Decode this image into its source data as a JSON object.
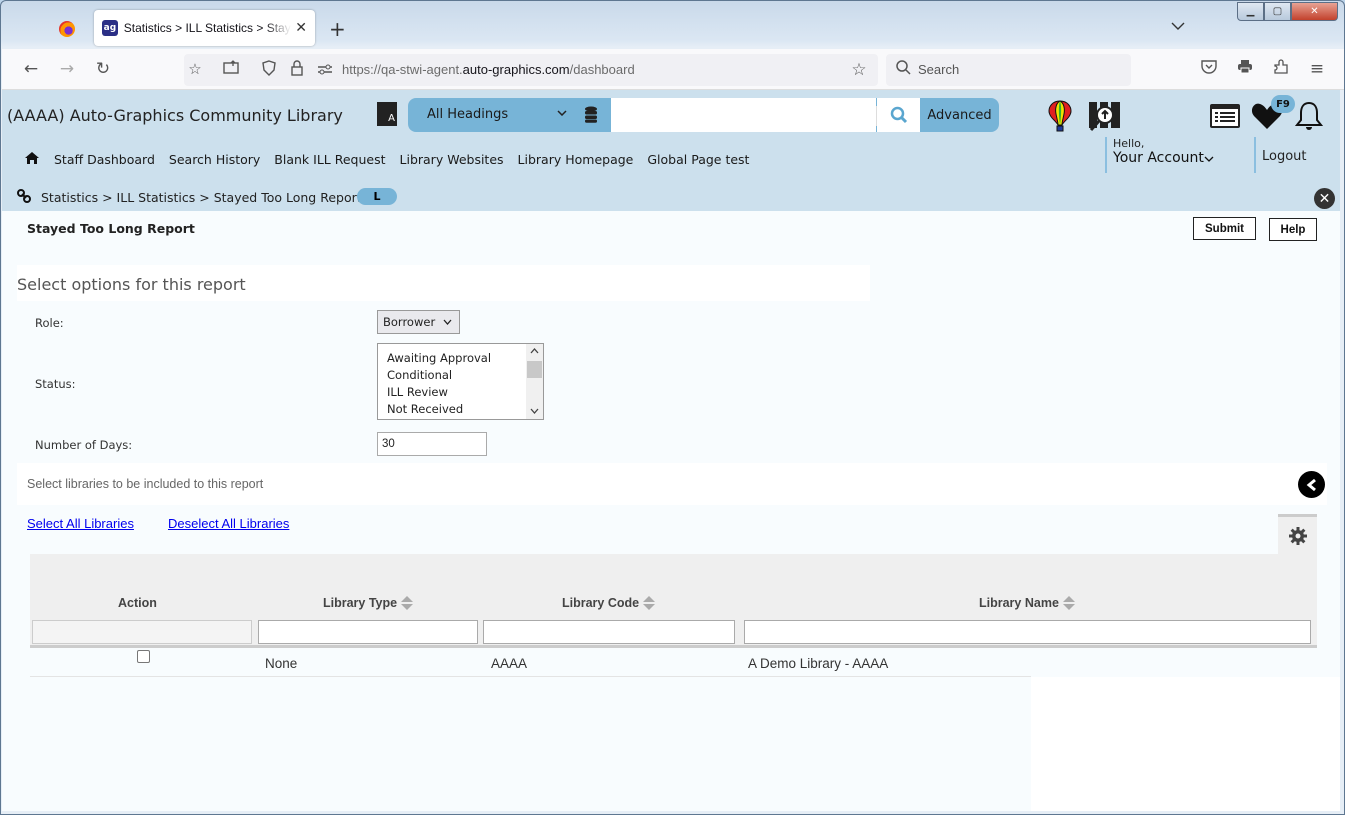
{
  "browser": {
    "tab_title": "Statistics > ILL Statistics > Stayed Too Long Report",
    "tab_favicon": "ag",
    "url_prefix": "https://qa-stwi-agent.",
    "url_domain": "auto-graphics.com",
    "url_path": "/dashboard",
    "search_placeholder": "Search",
    "icons": {
      "back": "←",
      "forward": "→",
      "reload": "↻",
      "new_tab": "+",
      "tab_close": "✕",
      "tab_list": "⌄",
      "minimize": "▁",
      "maximize": "▢",
      "close": "✕",
      "search": "⚲",
      "star": "☆",
      "pocket": "⊽",
      "print": "⎙",
      "extensions": "⧉",
      "menu": "≡"
    }
  },
  "header": {
    "library_name": "(AAAA) Auto-Graphics Community Library",
    "search_scope": "All Headings",
    "search_value": "",
    "advanced_label": "Advanced",
    "badge_label": "F9",
    "hello": "Hello,",
    "account_label": "Your Account",
    "logout_label": "Logout",
    "menu": [
      "Staff Dashboard",
      "Search History",
      "Blank ILL Request",
      "Library Websites",
      "Library Homepage",
      "Global Page test"
    ],
    "colors": {
      "header_bg": "#cce0ed",
      "accent": "#77b4d7"
    }
  },
  "breadcrumb": {
    "text": "Statistics > ILL Statistics > Stayed Too Long Report",
    "badge": "L"
  },
  "report": {
    "title": "Stayed Too Long Report",
    "submit_label": "Submit",
    "help_label": "Help",
    "options_title": "Select options for this report",
    "role_label": "Role:",
    "role_value": "Borrower",
    "status_label": "Status:",
    "status_options": [
      "Awaiting Approval",
      "Conditional",
      "ILL Review",
      "Not Received"
    ],
    "days_label": "Number of Days:",
    "days_value": "30",
    "libraries_title": "Select libraries to be included to this report",
    "select_all_label": "Select All Libraries",
    "deselect_all_label": "Deselect All Libraries"
  },
  "grid": {
    "columns": [
      "Action",
      "Library Type",
      "Library Code",
      "Library Name"
    ],
    "rows": [
      {
        "checked": false,
        "library_type": "None",
        "library_code": "AAAA",
        "library_name": "A Demo Library - AAAA"
      }
    ]
  }
}
